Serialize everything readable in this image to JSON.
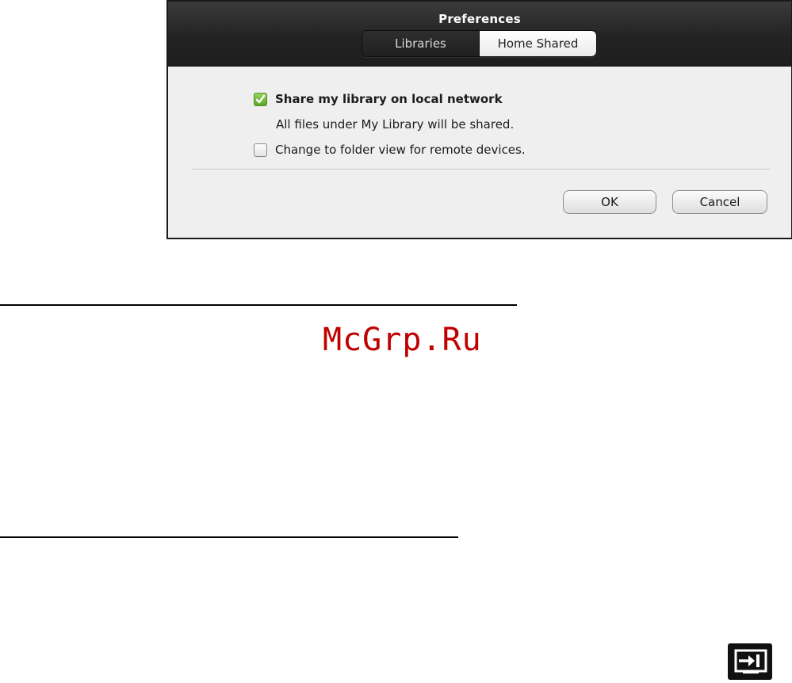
{
  "dialog": {
    "title": "Preferences",
    "tabs": [
      {
        "label": "Libraries",
        "selected": false
      },
      {
        "label": "Home Shared",
        "selected": true
      }
    ],
    "options": {
      "share_library": {
        "label": "Share my library on local network",
        "checked": true
      },
      "share_note": "All files under My Library will be shared.",
      "folder_view": {
        "label": "Change to folder view for remote devices.",
        "checked": false
      }
    },
    "buttons": {
      "ok": "OK",
      "cancel": "Cancel"
    }
  },
  "page": {
    "watermark": "McGrp.Ru",
    "icon": "input-source-icon"
  },
  "colors": {
    "titlebar": "#262626",
    "check_green": "#6cb332",
    "watermark": "#c00000"
  }
}
